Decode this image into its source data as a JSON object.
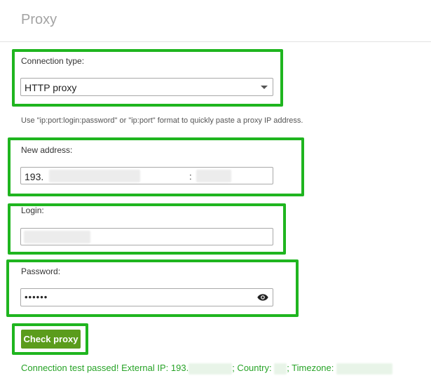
{
  "header": {
    "title": "Proxy"
  },
  "connection": {
    "label": "Connection type:",
    "selected": "HTTP proxy"
  },
  "hint": "Use \"ip:port:login:password\" or \"ip:port\" format to quickly paste a proxy IP address.",
  "address": {
    "label": "New address:",
    "value_prefix": "193.",
    "separator": ":"
  },
  "login": {
    "label": "Login:"
  },
  "password": {
    "label": "Password:",
    "masked": "••••••"
  },
  "check_button": "Check proxy",
  "status": {
    "prefix": "Connection test passed! External IP: 193.",
    "country_label": "; Country:",
    "timezone_label": "; Timezone:",
    "color": "#27a327"
  },
  "colors": {
    "highlight": "#1fb51f",
    "button": "#5b9c1c"
  }
}
